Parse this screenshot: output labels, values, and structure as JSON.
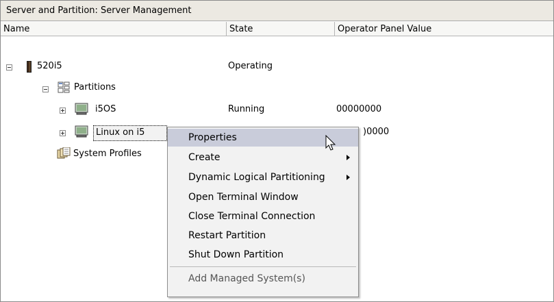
{
  "window": {
    "title": "Server and Partition: Server Management"
  },
  "columns": {
    "name": "Name",
    "state": "State",
    "operator_panel_value": "Operator Panel Value"
  },
  "tree": {
    "server": {
      "name": "520i5",
      "state": "Operating",
      "expanded": true
    },
    "partitions_folder": {
      "name": "Partitions",
      "expanded": true
    },
    "partition_i5os": {
      "name": "i5OS",
      "state": "Running",
      "opv": "00000000"
    },
    "partition_linux": {
      "name": "Linux on i5",
      "opv_visible": ")0000",
      "selected": true
    },
    "system_profiles": {
      "name": "System Profiles"
    }
  },
  "context_menu": {
    "items": [
      {
        "label": "Properties",
        "highlighted": true,
        "submenu": false
      },
      {
        "label": "Create",
        "submenu": true
      },
      {
        "label": "Dynamic Logical Partitioning",
        "submenu": true
      },
      {
        "label": "Open Terminal Window",
        "submenu": false
      },
      {
        "label": "Close Terminal Connection",
        "submenu": false
      },
      {
        "label": "Restart Partition",
        "submenu": false
      },
      {
        "label": "Shut Down Partition",
        "submenu": false
      },
      {
        "label": "Add Managed System(s)",
        "submenu": false,
        "disabled": true
      }
    ]
  },
  "colors": {
    "titlebar_bg": "#ece9e2",
    "menu_bg": "#f2f2f2",
    "menu_highlight": "#c9ccda",
    "watermark": "#e3e3e3"
  },
  "icons": {
    "server": "server-tower-icon",
    "partitions": "partitions-icon",
    "partition": "monitor-icon",
    "profiles": "system-profiles-icon",
    "cursor": "mouse-pointer-icon"
  }
}
